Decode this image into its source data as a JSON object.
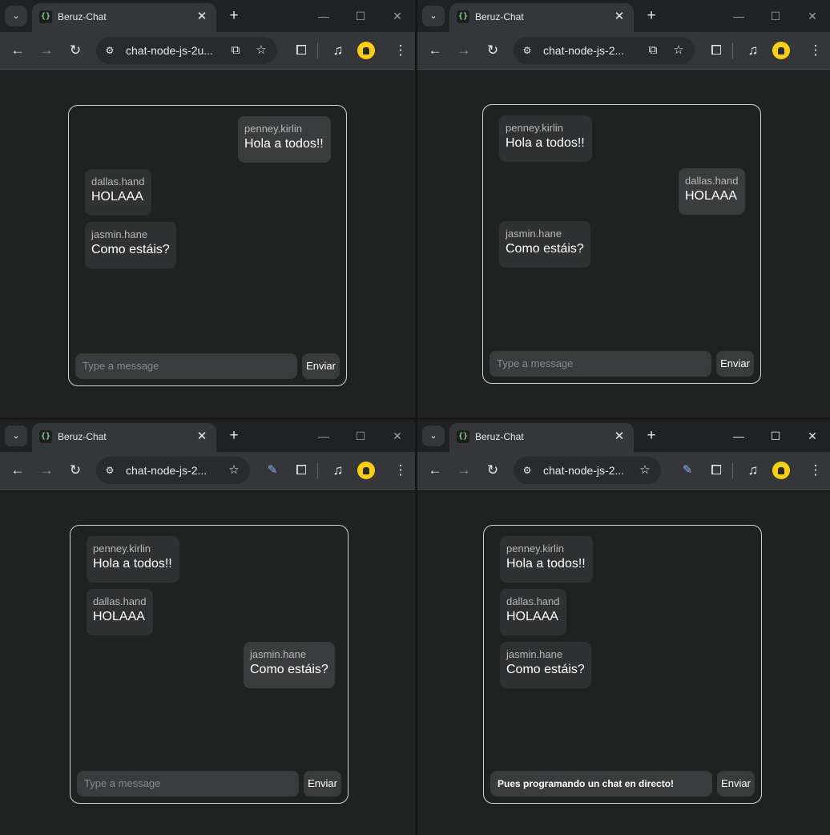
{
  "tab_title": "Beruz-Chat",
  "url_windows": [
    "chat-node-js-2u...",
    "chat-node-js-2...",
    "chat-node-js-2...",
    "chat-node-js-2..."
  ],
  "icons": {
    "tab_search": "chevron-down-icon",
    "favicon": "code-braces-icon",
    "close": "close-icon",
    "new_tab": "plus-icon",
    "minimize": "minimize-icon",
    "maximize": "maximize-icon",
    "window_close": "close-icon",
    "back": "arrow-left-icon",
    "forward": "arrow-right-icon",
    "reload": "reload-icon",
    "site_info": "tune-icon",
    "translate": "translate-icon",
    "bookmark": "star-icon",
    "eyedropper": "eyedropper-icon",
    "extensions": "puzzle-icon",
    "media": "media-queue-icon",
    "profile": "profile-lock-icon",
    "menu": "more-vert-icon"
  },
  "chat": {
    "messages": [
      {
        "user": "penney.kirlin",
        "text": "Hola a todos!!"
      },
      {
        "user": "dallas.hand",
        "text": "HOLAAA"
      },
      {
        "user": "jasmin.hane",
        "text": "Como estáis?"
      }
    ],
    "placeholder": "Type a message",
    "send_label": "Enviar",
    "draft_window4": "Pues programando un chat en directo!"
  },
  "colors": {
    "background": "#202121",
    "bubble": "#303132",
    "own_bubble": "#3b3c3d",
    "profile": "#f9cf16"
  }
}
